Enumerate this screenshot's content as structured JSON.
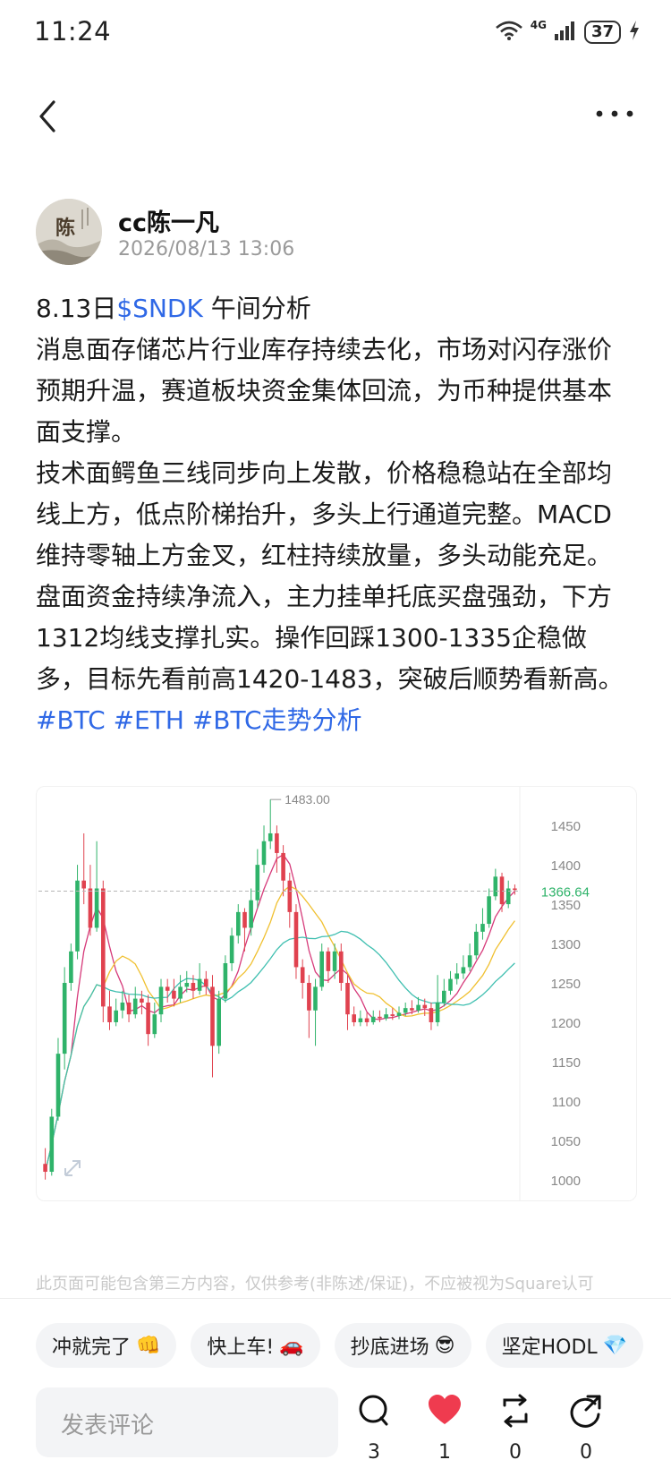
{
  "status_bar": {
    "time": "11:24",
    "network": "4G",
    "battery": "37",
    "icons": [
      "wifi-icon",
      "signal-icon",
      "battery-icon",
      "charging-icon"
    ]
  },
  "nav": {
    "back_icon": "chevron-left-icon",
    "more_icon": "more-dots-icon"
  },
  "author": {
    "name": "cc陈一凡",
    "date": "2026/08/13 13:06",
    "avatar_glyph": "陈"
  },
  "post": {
    "title_prefix": "8.13日",
    "ticker": "$SNDK",
    "title_suffix": " 午间分析",
    "para1": "消息面存储芯片行业库存持续去化，市场对闪存涨价预期升温，赛道板块资金集体回流，为币种提供基本面支撑。",
    "para2": "技术面鳄鱼三线同步向上发散，价格稳稳站在全部均线上方，低点阶梯抬升，多头上行通道完整。MACD维持零轴上方金叉，红柱持续放量，多头动能充足。",
    "para3": "盘面资金持续净流入，主力挂单托底买盘强劲，下方1312均线支撑扎实。操作回踩1300-1335企稳做多，目标先看前高1420-1483，突破后顺势看新高。",
    "tags": [
      "#BTC",
      "#ETH",
      "#BTC走势分析"
    ]
  },
  "chart_data": {
    "type": "candlestick",
    "y_ticks": [
      1450,
      1400,
      1350,
      1300,
      1250,
      1200,
      1150,
      1100,
      1050,
      1000
    ],
    "ylim": [
      985,
      1490
    ],
    "high_label": "1483.00",
    "current_price": "1366.64",
    "current_value": 1366.64,
    "expand_icon": "expand-icon",
    "colors": {
      "up": "#2fb36a",
      "down": "#e0424f",
      "price_line": "#b5b5b5",
      "ma_pink": "#d63a7a",
      "ma_yellow": "#f0c030",
      "ma_cyan": "#3fbfb0"
    },
    "candles": [
      [
        1020,
        1010,
        1040,
        1000
      ],
      [
        1010,
        1080,
        1090,
        1005
      ],
      [
        1080,
        1160,
        1180,
        1075
      ],
      [
        1160,
        1250,
        1270,
        1140
      ],
      [
        1250,
        1290,
        1300,
        1240
      ],
      [
        1290,
        1380,
        1400,
        1280
      ],
      [
        1380,
        1370,
        1440,
        1350
      ],
      [
        1370,
        1320,
        1400,
        1310
      ],
      [
        1320,
        1370,
        1430,
        1315
      ],
      [
        1370,
        1220,
        1380,
        1200
      ],
      [
        1220,
        1200,
        1240,
        1190
      ],
      [
        1200,
        1215,
        1230,
        1195
      ],
      [
        1215,
        1225,
        1240,
        1205
      ],
      [
        1225,
        1210,
        1235,
        1200
      ],
      [
        1210,
        1230,
        1245,
        1205
      ],
      [
        1230,
        1225,
        1240,
        1210
      ],
      [
        1225,
        1185,
        1235,
        1170
      ],
      [
        1185,
        1210,
        1225,
        1180
      ],
      [
        1210,
        1245,
        1255,
        1200
      ],
      [
        1245,
        1240,
        1255,
        1225
      ],
      [
        1240,
        1230,
        1255,
        1220
      ],
      [
        1230,
        1245,
        1260,
        1225
      ],
      [
        1245,
        1250,
        1265,
        1238
      ],
      [
        1250,
        1240,
        1260,
        1230
      ],
      [
        1240,
        1255,
        1275,
        1235
      ],
      [
        1255,
        1245,
        1265,
        1235
      ],
      [
        1245,
        1170,
        1260,
        1130
      ],
      [
        1170,
        1230,
        1240,
        1160
      ],
      [
        1230,
        1275,
        1285,
        1225
      ],
      [
        1275,
        1310,
        1320,
        1265
      ],
      [
        1310,
        1340,
        1350,
        1300
      ],
      [
        1340,
        1320,
        1345,
        1290
      ],
      [
        1320,
        1355,
        1370,
        1310
      ],
      [
        1355,
        1400,
        1420,
        1345
      ],
      [
        1400,
        1430,
        1450,
        1390
      ],
      [
        1430,
        1440,
        1483,
        1420
      ],
      [
        1440,
        1415,
        1450,
        1390
      ],
      [
        1415,
        1380,
        1425,
        1360
      ],
      [
        1380,
        1340,
        1390,
        1320
      ],
      [
        1340,
        1270,
        1350,
        1255
      ],
      [
        1270,
        1250,
        1280,
        1230
      ],
      [
        1250,
        1215,
        1260,
        1180
      ],
      [
        1215,
        1245,
        1255,
        1170
      ],
      [
        1245,
        1290,
        1300,
        1240
      ],
      [
        1290,
        1265,
        1295,
        1250
      ],
      [
        1265,
        1290,
        1300,
        1255
      ],
      [
        1290,
        1250,
        1300,
        1240
      ],
      [
        1250,
        1210,
        1260,
        1190
      ],
      [
        1210,
        1200,
        1220,
        1195
      ],
      [
        1200,
        1205,
        1215,
        1195
      ],
      [
        1205,
        1200,
        1212,
        1195
      ],
      [
        1200,
        1207,
        1215,
        1197
      ],
      [
        1207,
        1205,
        1215,
        1200
      ],
      [
        1205,
        1210,
        1218,
        1202
      ],
      [
        1210,
        1208,
        1218,
        1203
      ],
      [
        1208,
        1212,
        1220,
        1204
      ],
      [
        1212,
        1218,
        1225,
        1208
      ],
      [
        1218,
        1215,
        1228,
        1210
      ],
      [
        1215,
        1222,
        1232,
        1212
      ],
      [
        1222,
        1218,
        1230,
        1208
      ],
      [
        1218,
        1200,
        1225,
        1190
      ],
      [
        1200,
        1225,
        1260,
        1195
      ],
      [
        1225,
        1240,
        1255,
        1220
      ],
      [
        1240,
        1255,
        1265,
        1235
      ],
      [
        1255,
        1262,
        1275,
        1248
      ],
      [
        1262,
        1270,
        1285,
        1255
      ],
      [
        1270,
        1285,
        1300,
        1265
      ],
      [
        1285,
        1315,
        1325,
        1280
      ],
      [
        1315,
        1325,
        1345,
        1305
      ],
      [
        1325,
        1360,
        1370,
        1320
      ],
      [
        1360,
        1385,
        1395,
        1355
      ],
      [
        1385,
        1350,
        1390,
        1340
      ],
      [
        1350,
        1370,
        1380,
        1345
      ],
      [
        1370,
        1368,
        1375,
        1362
      ]
    ]
  },
  "disclaimer": "此页面可能包含第三方内容，仅供参考(非陈述/保证)，不应被视为Square认可",
  "quick_replies": [
    {
      "label": "冲就完了",
      "emoji": "👊"
    },
    {
      "label": "快上车!",
      "emoji": "🚗"
    },
    {
      "label": "抄底进场",
      "emoji": "😎"
    },
    {
      "label": "坚定HODL",
      "emoji": "💎"
    }
  ],
  "comment": {
    "placeholder": "发表评论"
  },
  "actions": {
    "comment_count": "3",
    "like_count": "1",
    "repost_count": "0",
    "share_count": "0"
  }
}
